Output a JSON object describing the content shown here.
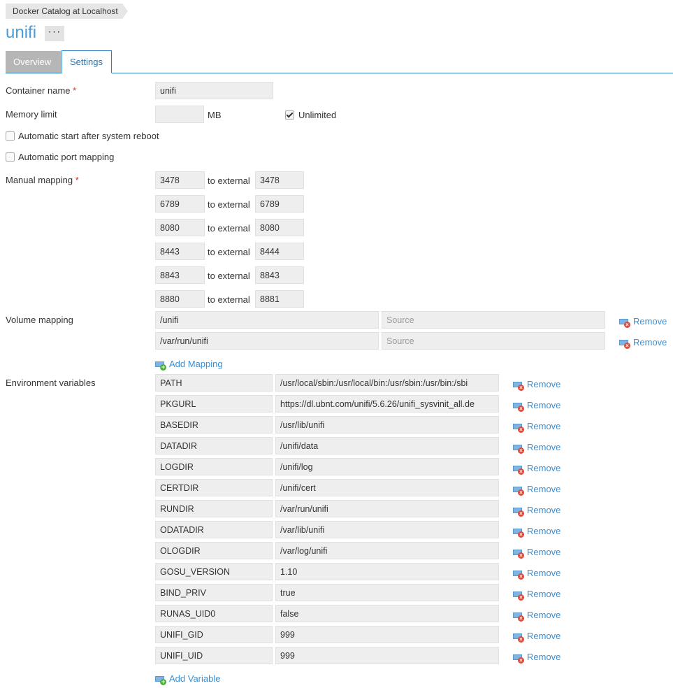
{
  "breadcrumb": "Docker Catalog at Localhost",
  "title": "unifi",
  "more_button": "···",
  "tabs": {
    "overview": "Overview",
    "settings": "Settings"
  },
  "form": {
    "container_name": {
      "label": "Container name",
      "required": "*",
      "value": "unifi"
    },
    "memory_limit": {
      "label": "Memory limit",
      "value": "",
      "unit": "MB",
      "unlimited_label": "Unlimited",
      "unlimited_checked": true
    },
    "auto_start": {
      "label": "Automatic start after system reboot",
      "checked": false
    },
    "auto_port": {
      "label": "Automatic port mapping",
      "checked": false
    },
    "manual_mapping": {
      "label": "Manual mapping",
      "required": "*",
      "connector": "to external",
      "rows": [
        {
          "internal": "3478",
          "external": "3478"
        },
        {
          "internal": "6789",
          "external": "6789"
        },
        {
          "internal": "8080",
          "external": "8080"
        },
        {
          "internal": "8443",
          "external": "8444"
        },
        {
          "internal": "8843",
          "external": "8843"
        },
        {
          "internal": "8880",
          "external": "8881"
        }
      ]
    },
    "volume_mapping": {
      "label": "Volume mapping",
      "rows": [
        {
          "target": "/unifi",
          "source_placeholder": "Source"
        },
        {
          "target": "/var/run/unifi",
          "source_placeholder": "Source"
        }
      ],
      "remove_label": "Remove",
      "add_label": "Add Mapping"
    },
    "environment": {
      "label": "Environment variables",
      "rows": [
        {
          "name": "PATH",
          "value": "/usr/local/sbin:/usr/local/bin:/usr/sbin:/usr/bin:/sbi"
        },
        {
          "name": "PKGURL",
          "value": "https://dl.ubnt.com/unifi/5.6.26/unifi_sysvinit_all.de"
        },
        {
          "name": "BASEDIR",
          "value": "/usr/lib/unifi"
        },
        {
          "name": "DATADIR",
          "value": "/unifi/data"
        },
        {
          "name": "LOGDIR",
          "value": "/unifi/log"
        },
        {
          "name": "CERTDIR",
          "value": "/unifi/cert"
        },
        {
          "name": "RUNDIR",
          "value": "/var/run/unifi"
        },
        {
          "name": "ODATADIR",
          "value": "/var/lib/unifi"
        },
        {
          "name": "OLOGDIR",
          "value": "/var/log/unifi"
        },
        {
          "name": "GOSU_VERSION",
          "value": "1.10"
        },
        {
          "name": "BIND_PRIV",
          "value": "true"
        },
        {
          "name": "RUNAS_UID0",
          "value": "false"
        },
        {
          "name": "UNIFI_GID",
          "value": "999"
        },
        {
          "name": "UNIFI_UID",
          "value": "999"
        }
      ],
      "remove_label": "Remove",
      "add_label": "Add Variable"
    }
  }
}
